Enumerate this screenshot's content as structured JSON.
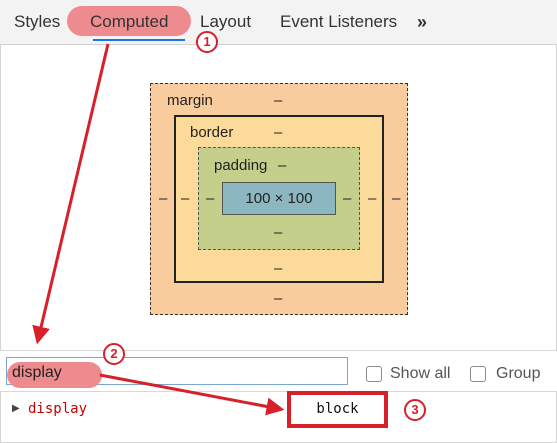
{
  "tabs": {
    "styles": "Styles",
    "computed": "Computed",
    "layout": "Layout",
    "event_listeners": "Event Listeners",
    "more": "»"
  },
  "box_model": {
    "margin_label": "margin",
    "border_label": "border",
    "padding_label": "padding",
    "content_size": "100 × 100",
    "empty_value": "–"
  },
  "filter": {
    "value": "display",
    "show_all_label": "Show all",
    "group_label": "Group"
  },
  "property": {
    "name": "display",
    "value": "block"
  },
  "annotations": {
    "step1": "1",
    "step2": "2",
    "step3": "3"
  },
  "colors": {
    "highlight": "#ee8b8e",
    "annotation_red": "#d8202a",
    "margin": "#f9cc9d",
    "border": "#fcdb9a",
    "padding": "#c3cf8b",
    "content": "#8cb6c0"
  }
}
